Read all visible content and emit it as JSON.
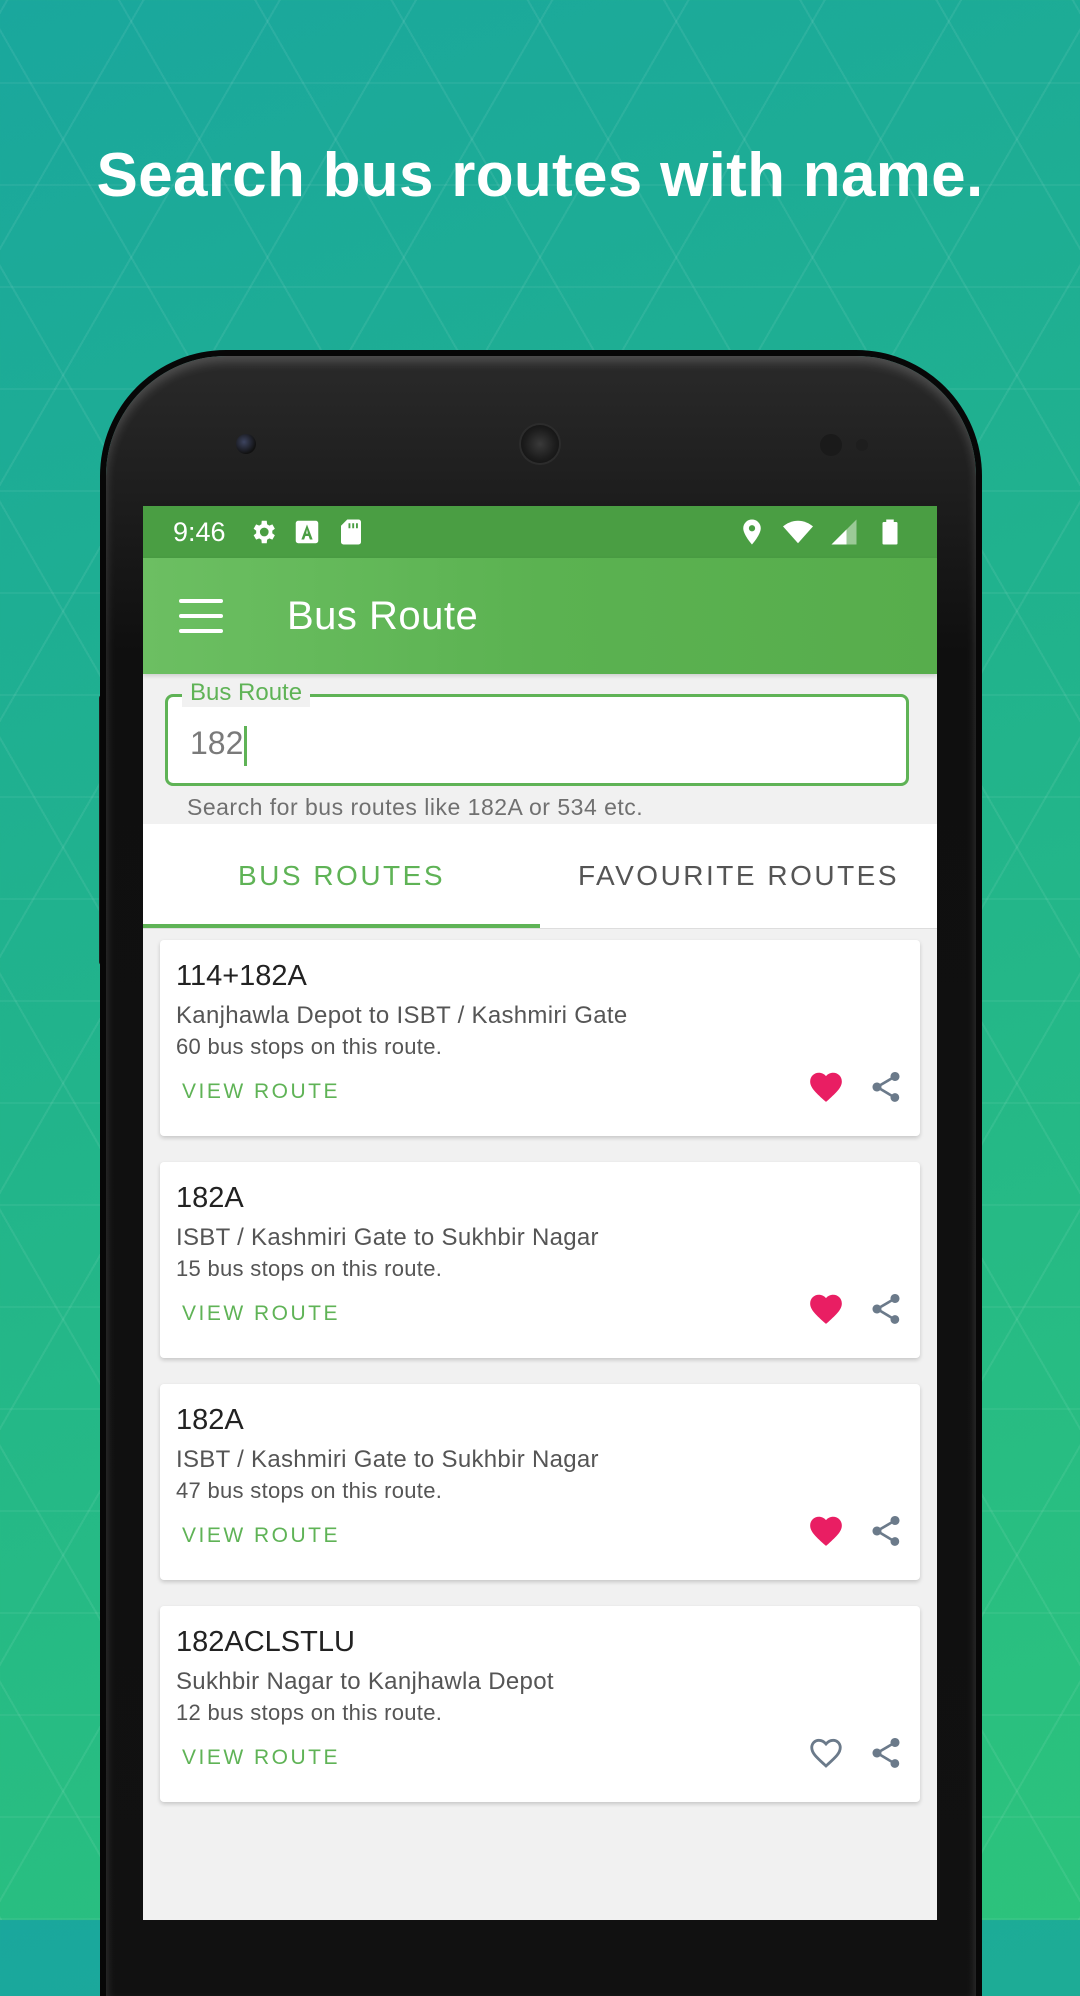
{
  "headline": "Search bus routes with name.",
  "status_bar": {
    "time": "9:46"
  },
  "app_bar": {
    "title": "Bus Route"
  },
  "search": {
    "label": "Bus Route",
    "value": "182",
    "helper": "Search for bus routes like 182A or 534 etc."
  },
  "tabs": [
    {
      "label": "BUS ROUTES",
      "active": true
    },
    {
      "label": "FAVOURITE ROUTES",
      "active": false
    }
  ],
  "routes": [
    {
      "name": "114+182A",
      "path": "Kanjhawla Depot to ISBT / Kashmiri Gate",
      "stops": "60 bus stops on this route.",
      "action": "VIEW ROUTE",
      "favourite": true
    },
    {
      "name": "182A",
      "path": "ISBT / Kashmiri Gate to Sukhbir Nagar",
      "stops": "15 bus stops on this route.",
      "action": "VIEW ROUTE",
      "favourite": true
    },
    {
      "name": "182A",
      "path": "ISBT / Kashmiri Gate to Sukhbir Nagar",
      "stops": "47 bus stops on this route.",
      "action": "VIEW ROUTE",
      "favourite": true
    },
    {
      "name": "182ACLSTLU",
      "path": "Sukhbir Nagar to Kanjhawla Depot",
      "stops": "12 bus stops on this route.",
      "action": "VIEW ROUTE",
      "favourite": false
    }
  ],
  "colors": {
    "primary": "#5fb356",
    "status_bar": "#4a9e43",
    "favourite": "#e91e63",
    "icon_gray": "#6b7a8a"
  },
  "icons": [
    "gear-icon",
    "font-icon",
    "sd-card-icon",
    "location-icon",
    "wifi-icon",
    "signal-icon",
    "battery-icon",
    "menu-icon",
    "heart-icon",
    "share-icon"
  ]
}
